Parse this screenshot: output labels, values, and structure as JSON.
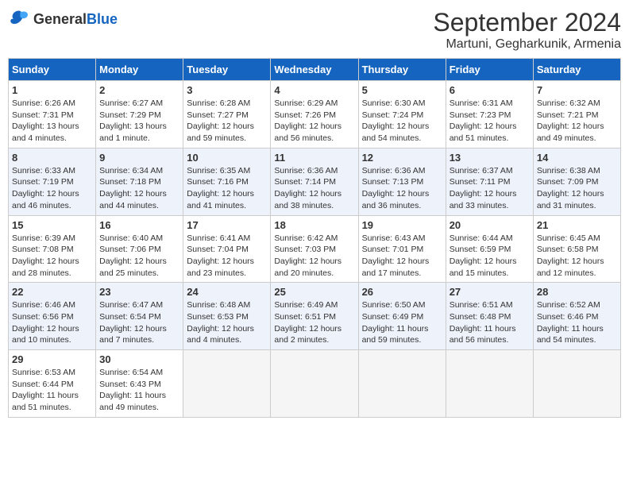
{
  "logo": {
    "general": "General",
    "blue": "Blue"
  },
  "title": {
    "month": "September 2024",
    "location": "Martuni, Gegharkunik, Armenia"
  },
  "days_of_week": [
    "Sunday",
    "Monday",
    "Tuesday",
    "Wednesday",
    "Thursday",
    "Friday",
    "Saturday"
  ],
  "weeks": [
    [
      {
        "day": "1",
        "info": "Sunrise: 6:26 AM\nSunset: 7:31 PM\nDaylight: 13 hours and 4 minutes."
      },
      {
        "day": "2",
        "info": "Sunrise: 6:27 AM\nSunset: 7:29 PM\nDaylight: 13 hours and 1 minute."
      },
      {
        "day": "3",
        "info": "Sunrise: 6:28 AM\nSunset: 7:27 PM\nDaylight: 12 hours and 59 minutes."
      },
      {
        "day": "4",
        "info": "Sunrise: 6:29 AM\nSunset: 7:26 PM\nDaylight: 12 hours and 56 minutes."
      },
      {
        "day": "5",
        "info": "Sunrise: 6:30 AM\nSunset: 7:24 PM\nDaylight: 12 hours and 54 minutes."
      },
      {
        "day": "6",
        "info": "Sunrise: 6:31 AM\nSunset: 7:23 PM\nDaylight: 12 hours and 51 minutes."
      },
      {
        "day": "7",
        "info": "Sunrise: 6:32 AM\nSunset: 7:21 PM\nDaylight: 12 hours and 49 minutes."
      }
    ],
    [
      {
        "day": "8",
        "info": "Sunrise: 6:33 AM\nSunset: 7:19 PM\nDaylight: 12 hours and 46 minutes."
      },
      {
        "day": "9",
        "info": "Sunrise: 6:34 AM\nSunset: 7:18 PM\nDaylight: 12 hours and 44 minutes."
      },
      {
        "day": "10",
        "info": "Sunrise: 6:35 AM\nSunset: 7:16 PM\nDaylight: 12 hours and 41 minutes."
      },
      {
        "day": "11",
        "info": "Sunrise: 6:36 AM\nSunset: 7:14 PM\nDaylight: 12 hours and 38 minutes."
      },
      {
        "day": "12",
        "info": "Sunrise: 6:36 AM\nSunset: 7:13 PM\nDaylight: 12 hours and 36 minutes."
      },
      {
        "day": "13",
        "info": "Sunrise: 6:37 AM\nSunset: 7:11 PM\nDaylight: 12 hours and 33 minutes."
      },
      {
        "day": "14",
        "info": "Sunrise: 6:38 AM\nSunset: 7:09 PM\nDaylight: 12 hours and 31 minutes."
      }
    ],
    [
      {
        "day": "15",
        "info": "Sunrise: 6:39 AM\nSunset: 7:08 PM\nDaylight: 12 hours and 28 minutes."
      },
      {
        "day": "16",
        "info": "Sunrise: 6:40 AM\nSunset: 7:06 PM\nDaylight: 12 hours and 25 minutes."
      },
      {
        "day": "17",
        "info": "Sunrise: 6:41 AM\nSunset: 7:04 PM\nDaylight: 12 hours and 23 minutes."
      },
      {
        "day": "18",
        "info": "Sunrise: 6:42 AM\nSunset: 7:03 PM\nDaylight: 12 hours and 20 minutes."
      },
      {
        "day": "19",
        "info": "Sunrise: 6:43 AM\nSunset: 7:01 PM\nDaylight: 12 hours and 17 minutes."
      },
      {
        "day": "20",
        "info": "Sunrise: 6:44 AM\nSunset: 6:59 PM\nDaylight: 12 hours and 15 minutes."
      },
      {
        "day": "21",
        "info": "Sunrise: 6:45 AM\nSunset: 6:58 PM\nDaylight: 12 hours and 12 minutes."
      }
    ],
    [
      {
        "day": "22",
        "info": "Sunrise: 6:46 AM\nSunset: 6:56 PM\nDaylight: 12 hours and 10 minutes."
      },
      {
        "day": "23",
        "info": "Sunrise: 6:47 AM\nSunset: 6:54 PM\nDaylight: 12 hours and 7 minutes."
      },
      {
        "day": "24",
        "info": "Sunrise: 6:48 AM\nSunset: 6:53 PM\nDaylight: 12 hours and 4 minutes."
      },
      {
        "day": "25",
        "info": "Sunrise: 6:49 AM\nSunset: 6:51 PM\nDaylight: 12 hours and 2 minutes."
      },
      {
        "day": "26",
        "info": "Sunrise: 6:50 AM\nSunset: 6:49 PM\nDaylight: 11 hours and 59 minutes."
      },
      {
        "day": "27",
        "info": "Sunrise: 6:51 AM\nSunset: 6:48 PM\nDaylight: 11 hours and 56 minutes."
      },
      {
        "day": "28",
        "info": "Sunrise: 6:52 AM\nSunset: 6:46 PM\nDaylight: 11 hours and 54 minutes."
      }
    ],
    [
      {
        "day": "29",
        "info": "Sunrise: 6:53 AM\nSunset: 6:44 PM\nDaylight: 11 hours and 51 minutes."
      },
      {
        "day": "30",
        "info": "Sunrise: 6:54 AM\nSunset: 6:43 PM\nDaylight: 11 hours and 49 minutes."
      },
      null,
      null,
      null,
      null,
      null
    ]
  ]
}
